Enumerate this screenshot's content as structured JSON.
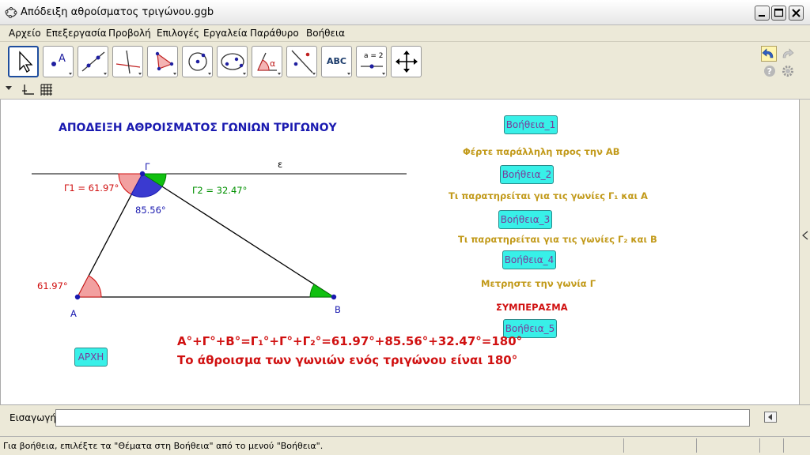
{
  "window": {
    "title": "Απόδειξη αθροίσματος τριγώνου.ggb"
  },
  "menu": [
    "Αρχείο",
    "Επεξεργασία",
    "Προβολή",
    "Επιλογές",
    "Εργαλεία",
    "Παράθυρο",
    "Βοήθεια"
  ],
  "toolbar": {
    "tools": [
      "move-tool",
      "point-tool",
      "line-tool",
      "perpendicular-tool",
      "polygon-tool",
      "circle-tool",
      "conic-tool",
      "angle-tool",
      "reflect-tool",
      "text-tool",
      "slider-tool",
      "move-view-tool"
    ],
    "text_tool_label": "ABC",
    "slider_tool_label": "a = 2"
  },
  "graphics": {
    "heading": "ΑΠΟΔΕΙΞΗ ΑΘΡΟΙΣΜΑΤΟΣ ΓΩΝΙΩΝ ΤΡΙΓΩΝΟΥ",
    "point_labels": {
      "A": "A",
      "B": "B",
      "G": "Γ",
      "line": "ε"
    },
    "angle_labels": {
      "g1": "Γ1 = 61.97°",
      "g2": "Γ2 = 32.47°",
      "g_center": "85.56°",
      "a": "61.97°"
    },
    "buttons": {
      "help1": "Βοήθεια_1",
      "help2": "Βοήθεια_2",
      "help3": "Βοήθεια_3",
      "help4": "Βοήθεια_4",
      "help5": "Βοήθεια_5",
      "start": "ΑΡΧΗ"
    },
    "hints": {
      "h1": "Φέρτε παράλληλη προς την ΑΒ",
      "h2": "Τι παρατηρείται για τις γωνίες Γ₁ και Α",
      "h3": "Τι παρατηρείται για τις γωνίες Γ₂ και Β",
      "h4": "Μετρηστε την γωνία Γ",
      "conclusion": "ΣΥΜΠΕΡΑΣΜΑ"
    },
    "formula": "A°+Γ°+B°=Γ₁°+Γ°+Γ₂°=61.97°+85.56°+32.47°=180°",
    "statement": "Το άθροισμα των γωνιών ενός τριγώνου είναι 180°"
  },
  "input_bar": {
    "label": "Εισαγωγή:",
    "value": ""
  },
  "status": {
    "text": "Για βοήθεια, επιλέξτε τα \"Θέματα στη Βοήθεια\" από το μενού \"Βοήθεια\"."
  },
  "colors": {
    "blue": "#1a1ab0",
    "red": "#d01010",
    "green": "#009000",
    "gold": "#c29a1a",
    "button": "#38f0e8"
  }
}
